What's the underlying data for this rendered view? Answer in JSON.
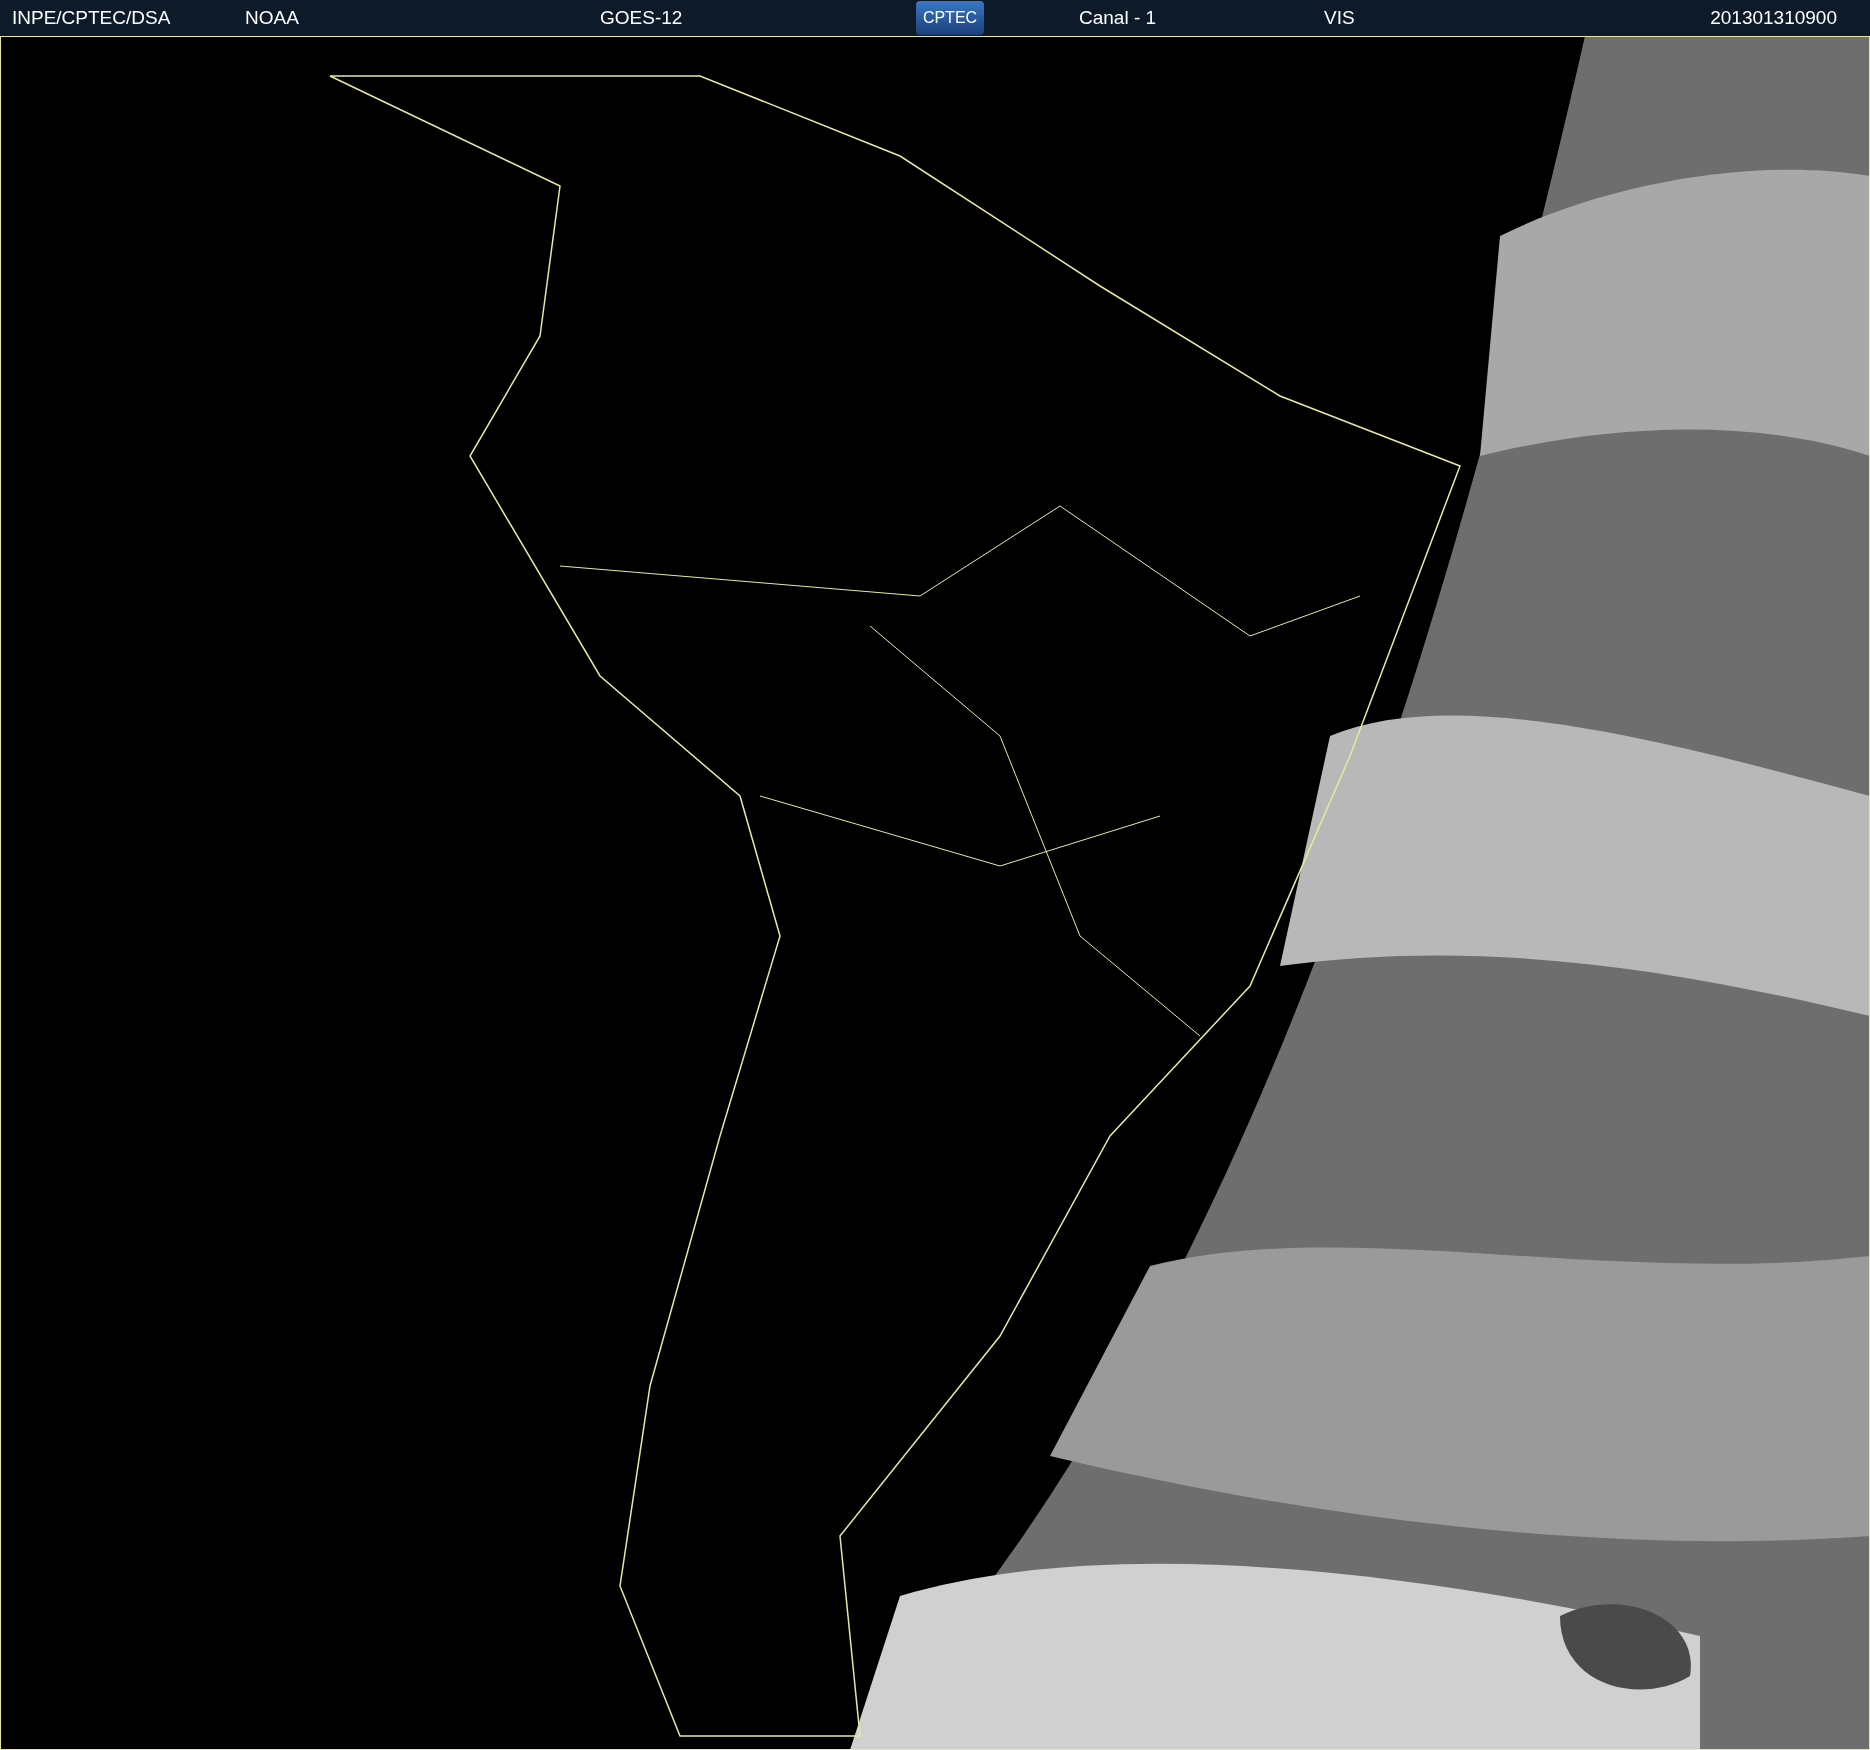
{
  "header": {
    "source": "INPE/CPTEC/DSA",
    "agency": "NOAA",
    "satellite": "GOES-12",
    "logo": "CPTEC",
    "channel": "Canal - 1",
    "band": "VIS",
    "timestamp": "201301310900"
  }
}
